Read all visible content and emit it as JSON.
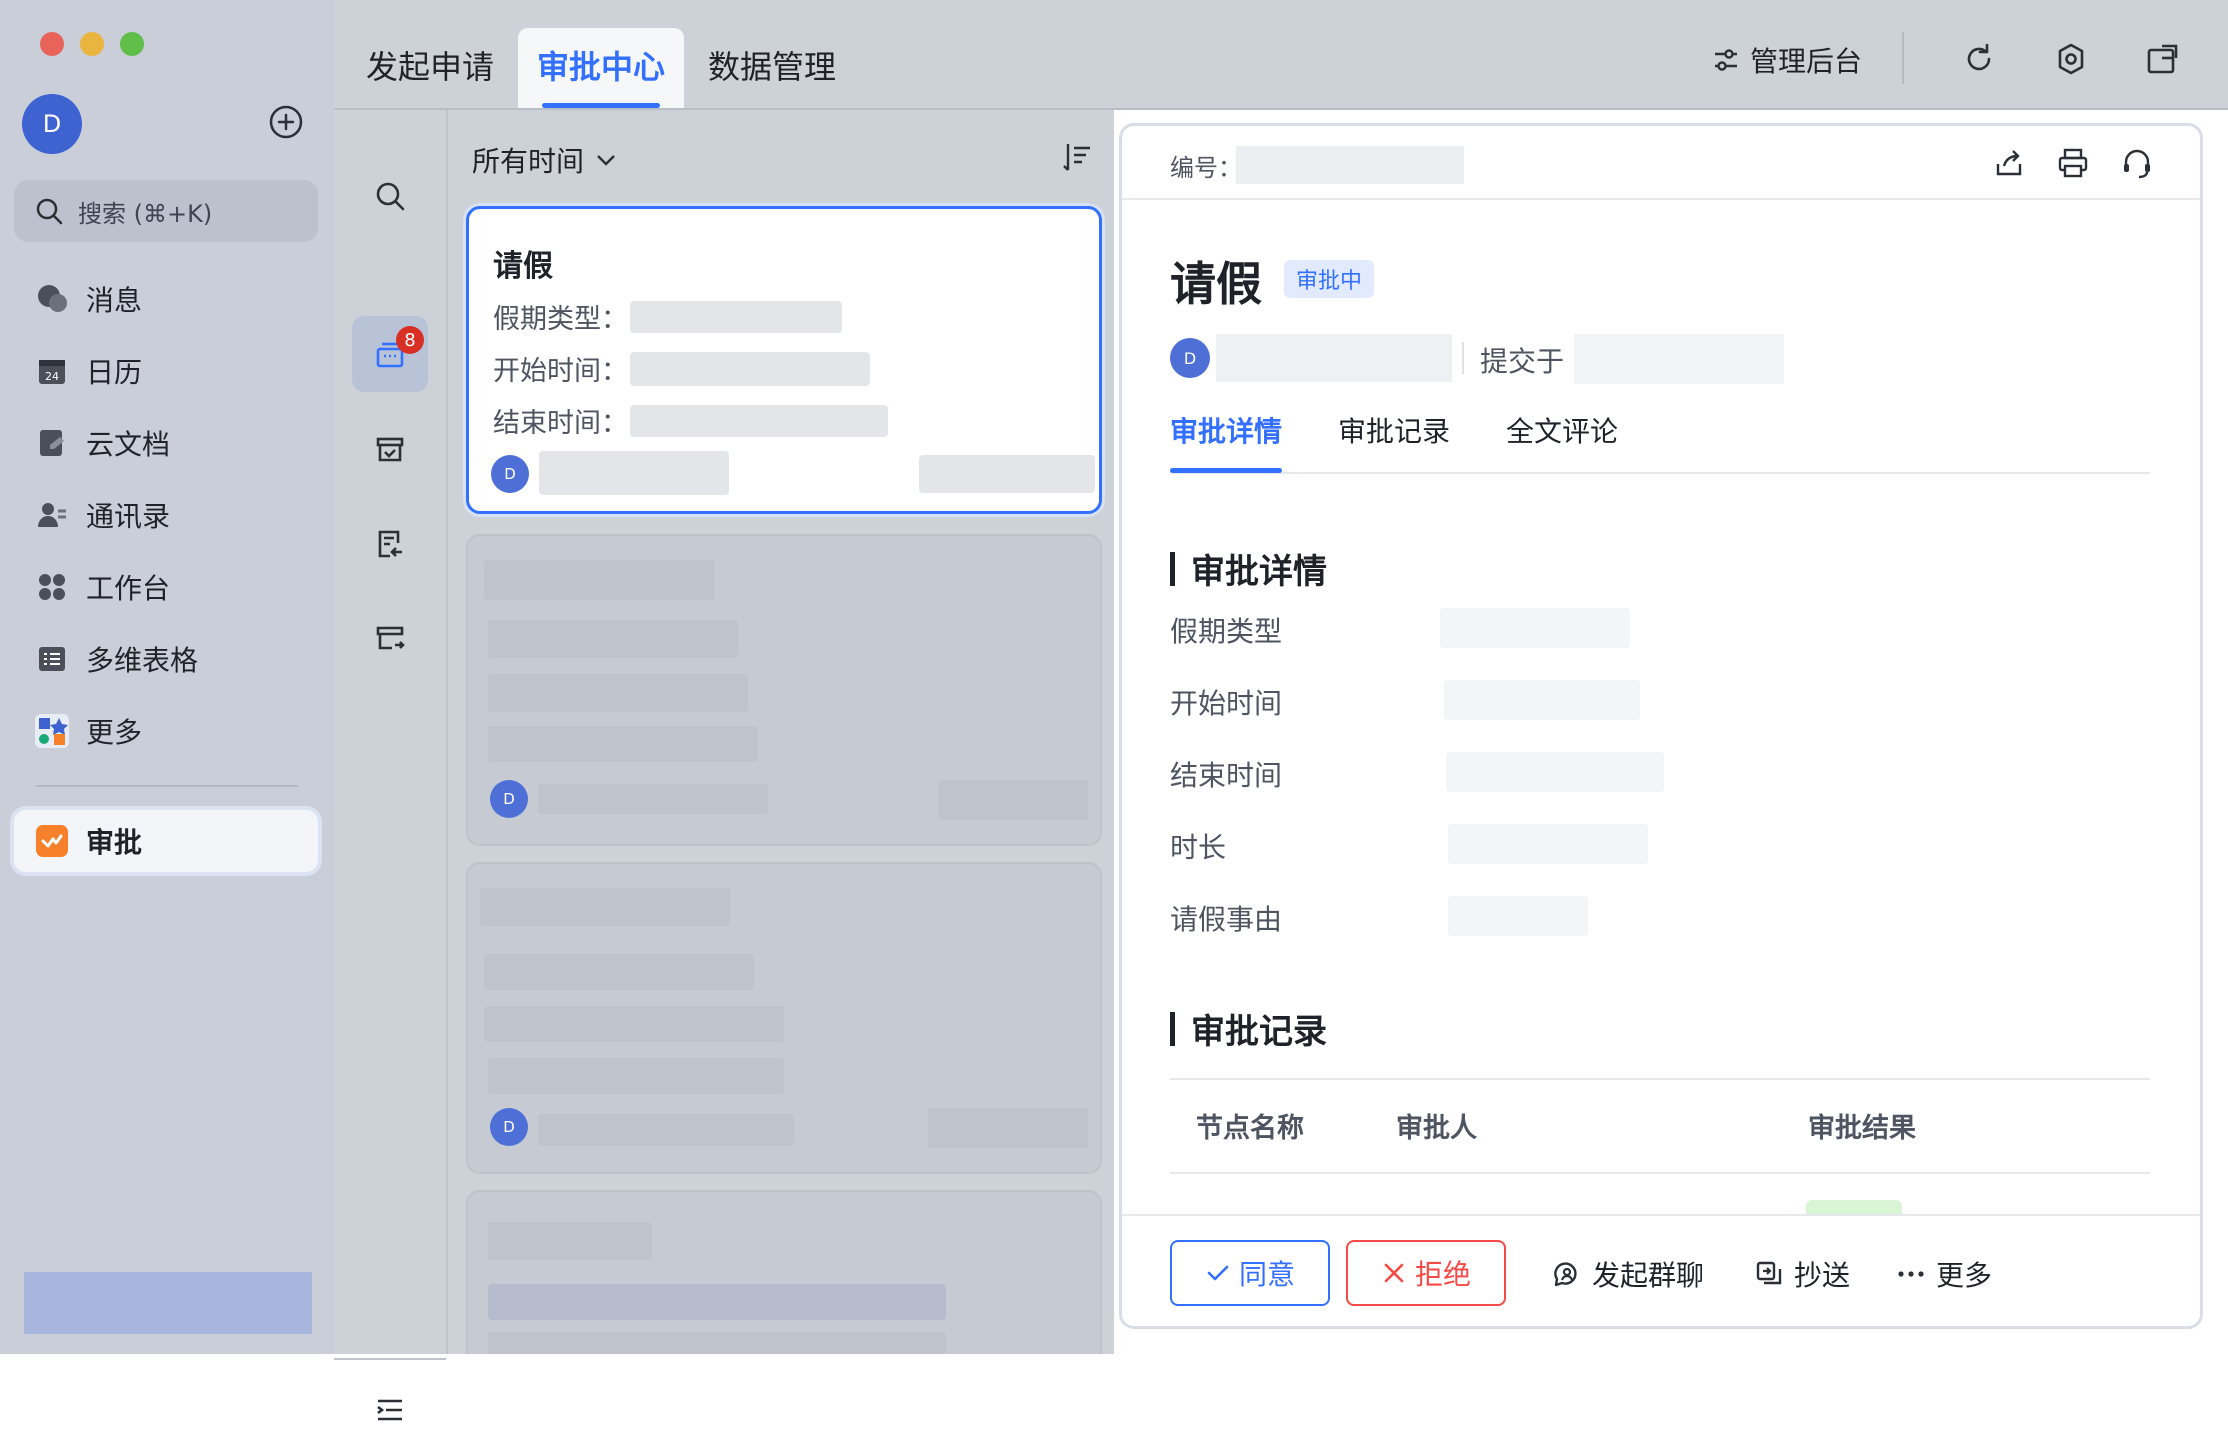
{
  "sidebar": {
    "avatar_letter": "D",
    "search_placeholder": "搜索 (⌘+K)",
    "items": [
      {
        "label": "消息"
      },
      {
        "label": "日历"
      },
      {
        "label": "云文档"
      },
      {
        "label": "通讯录"
      },
      {
        "label": "工作台"
      },
      {
        "label": "多维表格"
      },
      {
        "label": "更多"
      }
    ],
    "active_item": {
      "label": "审批"
    },
    "calendar_day": "24"
  },
  "topbar": {
    "tabs": [
      {
        "label": "发起申请"
      },
      {
        "label": "审批中心"
      },
      {
        "label": "数据管理"
      }
    ],
    "admin_label": "管理后台"
  },
  "rail": {
    "badge_count": "8"
  },
  "list": {
    "filter_label": "所有时间",
    "cards": [
      {
        "title": "请假",
        "field_labels": [
          "假期类型：",
          "开始时间：",
          "结束时间："
        ],
        "avatar_letter": "D"
      },
      {
        "avatar_letter": "D"
      },
      {
        "avatar_letter": "D"
      }
    ]
  },
  "detail": {
    "serial_label": "编号：",
    "title": "请假",
    "status": "审批中",
    "submitter_avatar": "D",
    "submitted_text": "提交于",
    "tabs": [
      {
        "label": "审批详情"
      },
      {
        "label": "审批记录"
      },
      {
        "label": "全文评论"
      }
    ],
    "section_details": "审批详情",
    "fields": [
      {
        "label": "假期类型"
      },
      {
        "label": "开始时间"
      },
      {
        "label": "结束时间"
      },
      {
        "label": "时长"
      },
      {
        "label": "请假事由"
      }
    ],
    "section_records": "审批记录",
    "record_columns": [
      "节点名称",
      "审批人",
      "审批结果"
    ]
  },
  "actions": {
    "approve": "同意",
    "reject": "拒绝",
    "group_chat": "发起群聊",
    "cc": "抄送",
    "more": "更多"
  },
  "colors": {
    "accent": "#3370ff",
    "reject": "#f54a45",
    "badge": "#d93026",
    "approval_app": "#f7812a"
  }
}
